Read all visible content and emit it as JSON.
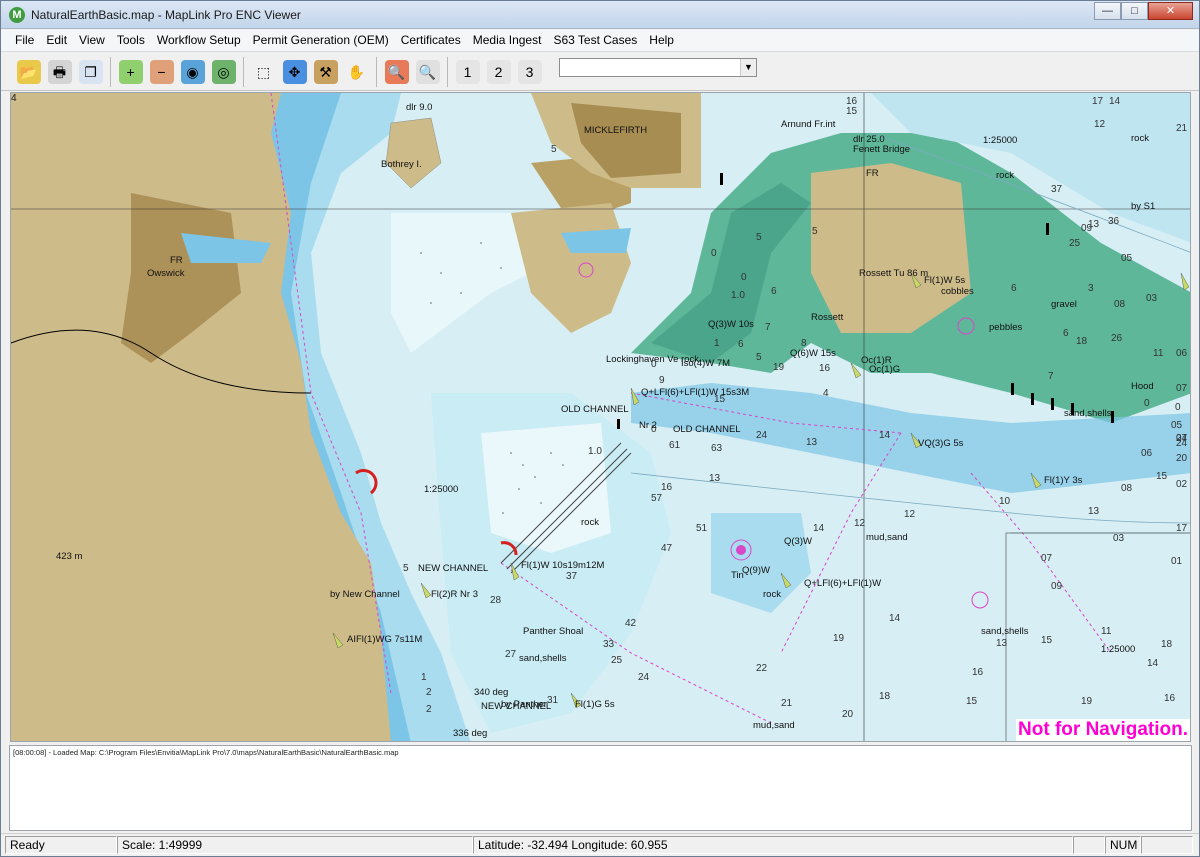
{
  "window": {
    "title": "NaturalEarthBasic.map - MapLink Pro ENC Viewer",
    "app_icon_letter": "M",
    "buttons": {
      "minimize": "—",
      "maximize": "□",
      "close": "✕"
    }
  },
  "menu": [
    "File",
    "Edit",
    "View",
    "Tools",
    "Workflow Setup",
    "Permit Generation (OEM)",
    "Certificates",
    "Media Ingest",
    "S63 Test Cases",
    "Help"
  ],
  "toolbar": {
    "buttons": [
      {
        "name": "open-icon",
        "glyph": "📂",
        "color": "#e9c94a"
      },
      {
        "name": "print-icon",
        "glyph": "🖶",
        "color": "#d4d4d4"
      },
      {
        "name": "copy-icon",
        "glyph": "❐",
        "color": "#d9e4f3"
      },
      {
        "name": "zoom-in-icon",
        "glyph": "+",
        "color": "#8fcf6d"
      },
      {
        "name": "zoom-out-icon",
        "glyph": "−",
        "color": "#e0a07a"
      },
      {
        "name": "globe-icon",
        "glyph": "◉",
        "color": "#5aa3d8"
      },
      {
        "name": "globe-refresh-icon",
        "glyph": "◎",
        "color": "#6db36b"
      },
      {
        "name": "zoom-box-icon",
        "glyph": "⬚",
        "color": "#f0f0f0"
      },
      {
        "name": "pan-icon",
        "glyph": "✥",
        "color": "#4a8fe0"
      },
      {
        "name": "measure-icon",
        "glyph": "⚒",
        "color": "#c8a060"
      },
      {
        "name": "hand-icon",
        "glyph": "✋",
        "color": "#f0f0f0"
      },
      {
        "name": "query-icon",
        "glyph": "🔍",
        "color": "#e87a5a"
      },
      {
        "name": "query-disabled-icon",
        "glyph": "🔍",
        "color": "#e0e0e0"
      },
      {
        "name": "scale-1-icon",
        "glyph": "1",
        "color": "#e5e5e5"
      },
      {
        "name": "scale-2-icon",
        "glyph": "2",
        "color": "#e5e5e5"
      },
      {
        "name": "scale-3-icon",
        "glyph": "3",
        "color": "#e5e5e5"
      }
    ],
    "combo_value": ""
  },
  "map": {
    "labels": [
      "MICKLEFIRTH",
      "Arnund Fr.int",
      "Fenett Bridge",
      "dlr 25.0",
      "FR",
      "Rossett Tu 86 m",
      "Fl(1)W 5s",
      "cobbles",
      "pebbles",
      "gravel",
      "Rossett",
      "Oc(1)R",
      "Oc(1)G",
      "Hood",
      "by S1",
      "rock",
      "1:25000",
      "sand,shells",
      "Lockinghaven Ve rock",
      "Q(3)W 10s",
      "Q(6)W 15s",
      "Iso(4)W 7M",
      "Q+LFl(6)+LFl(1)W 15s3M",
      "OLD CHANNEL",
      "Nr 2",
      "OLD CHANNEL",
      "VQ(3)G 5s",
      "Fl(1)Y 3s",
      "1:25000",
      "Bothrey I.",
      "dlr 9.0",
      "FR",
      "Owswick",
      "423 m",
      "NEW CHANNEL",
      "Fl(1)W 10s19m12M",
      "by New Channel",
      "Fl(2)R Nr 3",
      "AIFl(1)WG 7s11M",
      "Panther Shoal",
      "sand,shells",
      "340 deg",
      "by Panther",
      "NEW CHANNEL",
      "336 deg",
      "Fl(1)G 5s",
      "Q(3)W",
      "Q(9)W",
      "Q+LFl(6)+LFl(1)W",
      "mud,sand",
      "mud,sand",
      "sand,shells",
      "1:25000",
      "rock",
      "rock",
      "Tin",
      "rock"
    ],
    "soundings": [
      "14",
      "17",
      "16",
      "15",
      "12",
      "21",
      "37",
      "36",
      "25",
      "13",
      "09",
      "05",
      "08",
      "03",
      "26",
      "11",
      "06",
      "18",
      "27",
      "24",
      "20",
      "15",
      "13",
      "14",
      "24",
      "16",
      "19",
      "15",
      "13",
      "14",
      "12",
      "12",
      "14",
      "16",
      "13",
      "07",
      "15",
      "14",
      "18",
      "19",
      "16",
      "63",
      "61",
      "57",
      "51",
      "47",
      "42",
      "37",
      "33",
      "31",
      "28",
      "27",
      "25",
      "24",
      "22",
      "21",
      "20",
      "19",
      "18",
      "17",
      "16",
      "15",
      "13",
      "11",
      "10",
      "09",
      "08",
      "07",
      "06",
      "05",
      "04",
      "03",
      "02",
      "01",
      "1.0",
      "1.0",
      "5",
      "5",
      "5",
      "5",
      "5",
      "0",
      "0",
      "0",
      "0",
      "0",
      "2",
      "2",
      "1",
      "1",
      "0",
      "9",
      "8",
      "4",
      "3",
      "6",
      "6",
      "7",
      "6",
      "7",
      "6",
      "4",
      "4"
    ],
    "notice": "Not for Navigation."
  },
  "log": {
    "lines": [
      "[08:00:08] - Loaded Map: C:\\Program Files\\Envitia\\MapLink Pro\\7.0\\maps\\NaturalEarthBasic\\NaturalEarthBasic.map"
    ]
  },
  "status": {
    "ready": "Ready",
    "scale": "Scale: 1:49999",
    "coords": "Latitude: -32.494   Longitude: 60.955",
    "num": "NUM"
  }
}
